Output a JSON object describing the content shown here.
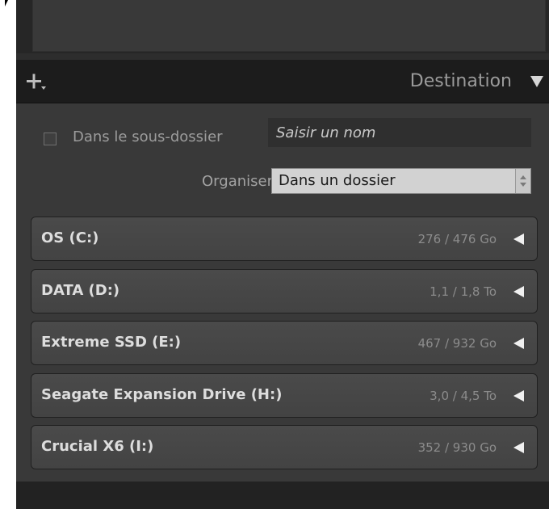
{
  "header": {
    "title": "Destination",
    "add_icon": "plus-dropdown-icon",
    "collapse_icon": "triangle-down-icon"
  },
  "subfolder": {
    "checked": false,
    "label": "Dans le sous-dossier",
    "placeholder": "Saisir un nom"
  },
  "organise": {
    "label": "Organiser",
    "value": "Dans un dossier"
  },
  "drives": [
    {
      "name": "OS (C:)",
      "size": "276 / 476 Go"
    },
    {
      "name": "DATA (D:)",
      "size": "1,1 / 1,8 To"
    },
    {
      "name": "Extreme SSD (E:)",
      "size": "467 / 932 Go"
    },
    {
      "name": "Seagate Expansion Drive (H:)",
      "size": "3,0 / 4,5 To"
    },
    {
      "name": "Crucial X6 (I:)",
      "size": "352 / 930 Go"
    }
  ],
  "colors": {
    "panel_bg": "#393939",
    "header_bg": "#1c1c1c",
    "drive_row_bg": "#474747",
    "text_light": "#dddddd",
    "text_muted": "#8c8c8c"
  }
}
